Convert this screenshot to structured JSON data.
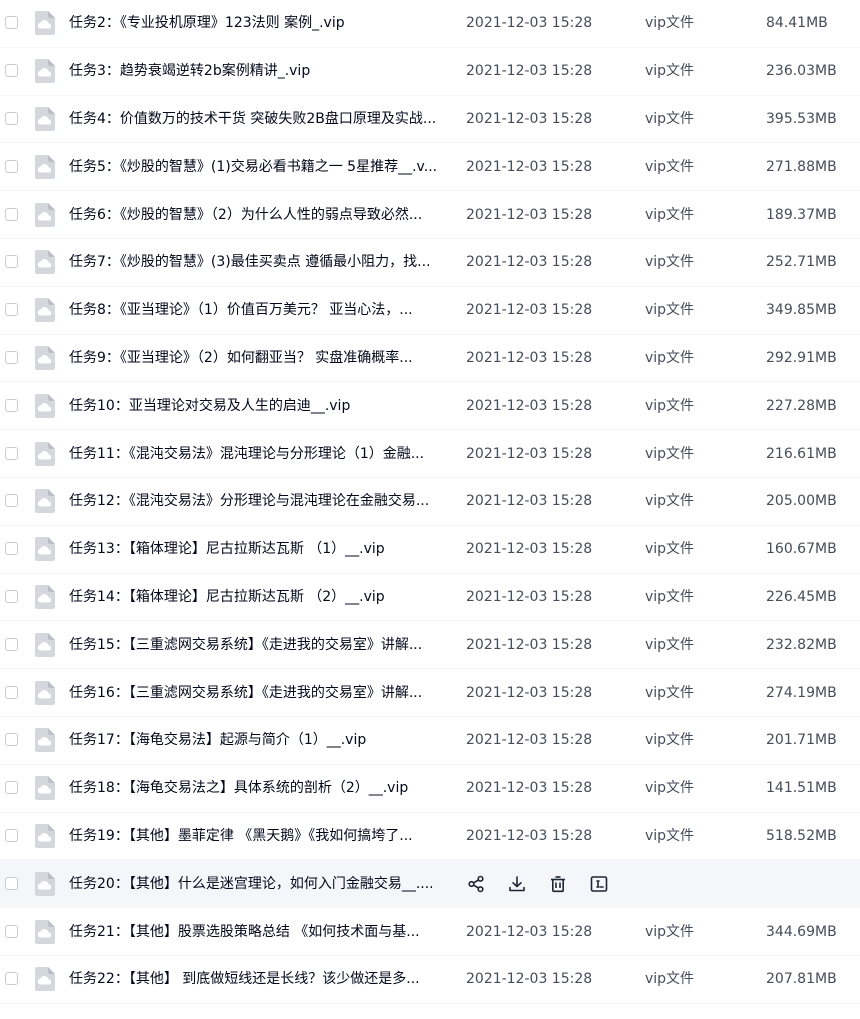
{
  "files": [
    {
      "name": "任务2：《专业投机原理》123法则 案例_.vip",
      "date": "2021-12-03 15:28",
      "type": "vip文件",
      "size": "84.41MB"
    },
    {
      "name": "任务3：趋势衰竭逆转2b案例精讲_.vip",
      "date": "2021-12-03 15:28",
      "type": "vip文件",
      "size": "236.03MB"
    },
    {
      "name": "任务4：价值数万的技术干货 突破失败2B盘口原理及实战...",
      "date": "2021-12-03 15:28",
      "type": "vip文件",
      "size": "395.53MB"
    },
    {
      "name": "任务5：《炒股的智慧》(1)交易必看书籍之一 5星推荐__.v...",
      "date": "2021-12-03 15:28",
      "type": "vip文件",
      "size": "271.88MB"
    },
    {
      "name": "任务6：《炒股的智慧》（2）为什么人性的弱点导致必然...",
      "date": "2021-12-03 15:28",
      "type": "vip文件",
      "size": "189.37MB"
    },
    {
      "name": "任务7：《炒股的智慧》(3)最佳买卖点 遵循最小阻力，找...",
      "date": "2021-12-03 15:28",
      "type": "vip文件",
      "size": "252.71MB"
    },
    {
      "name": "任务8：《亚当理论》（1）价值百万美元？ 亚当心法，...",
      "date": "2021-12-03 15:28",
      "type": "vip文件",
      "size": "349.85MB"
    },
    {
      "name": "任务9：《亚当理论》（2）如何翻亚当？ 实盘准确概率...",
      "date": "2021-12-03 15:28",
      "type": "vip文件",
      "size": "292.91MB"
    },
    {
      "name": "任务10：亚当理论对交易及人生的启迪__.vip",
      "date": "2021-12-03 15:28",
      "type": "vip文件",
      "size": "227.28MB"
    },
    {
      "name": "任务11：《混沌交易法》混沌理论与分形理论（1）金融...",
      "date": "2021-12-03 15:28",
      "type": "vip文件",
      "size": "216.61MB"
    },
    {
      "name": "任务12：《混沌交易法》分形理论与混沌理论在金融交易...",
      "date": "2021-12-03 15:28",
      "type": "vip文件",
      "size": "205.00MB"
    },
    {
      "name": "任务13：【箱体理论】尼古拉斯达瓦斯 （1）__.vip",
      "date": "2021-12-03 15:28",
      "type": "vip文件",
      "size": "160.67MB"
    },
    {
      "name": "任务14：【箱体理论】尼古拉斯达瓦斯 （2）__.vip",
      "date": "2021-12-03 15:28",
      "type": "vip文件",
      "size": "226.45MB"
    },
    {
      "name": "任务15：【三重滤网交易系统】《走进我的交易室》讲解...",
      "date": "2021-12-03 15:28",
      "type": "vip文件",
      "size": "232.82MB"
    },
    {
      "name": "任务16：【三重滤网交易系统】《走进我的交易室》讲解...",
      "date": "2021-12-03 15:28",
      "type": "vip文件",
      "size": "274.19MB"
    },
    {
      "name": "任务17：【海龟交易法】起源与简介（1）__.vip",
      "date": "2021-12-03 15:28",
      "type": "vip文件",
      "size": "201.71MB"
    },
    {
      "name": "任务18：【海龟交易法之】具体系统的剖析（2）__.vip",
      "date": "2021-12-03 15:28",
      "type": "vip文件",
      "size": "141.51MB"
    },
    {
      "name": "任务19：【其他】墨菲定律 《黑天鹅》《我如何搞垮了...",
      "date": "2021-12-03 15:28",
      "type": "vip文件",
      "size": "518.52MB"
    },
    {
      "name": "任务20：【其他】什么是迷宫理论，如何入门金融交易__....",
      "date": "",
      "type": "",
      "size": "",
      "hovered": true
    },
    {
      "name": "任务21：【其他】股票选股策略总结 《如何技术面与基...",
      "date": "2021-12-03 15:28",
      "type": "vip文件",
      "size": "344.69MB"
    },
    {
      "name": "任务22：【其他】 到底做短线还是长线？该少做还是多...",
      "date": "2021-12-03 15:28",
      "type": "vip文件",
      "size": "207.81MB"
    }
  ],
  "hover_actions": [
    "share-icon",
    "download-icon",
    "delete-icon",
    "rename-icon"
  ],
  "colors": {
    "name_text": "#03081a",
    "meta_text": "#454d5a",
    "hover_bg": "#f5f6fa",
    "icon_fill": "#d4d7dc"
  }
}
